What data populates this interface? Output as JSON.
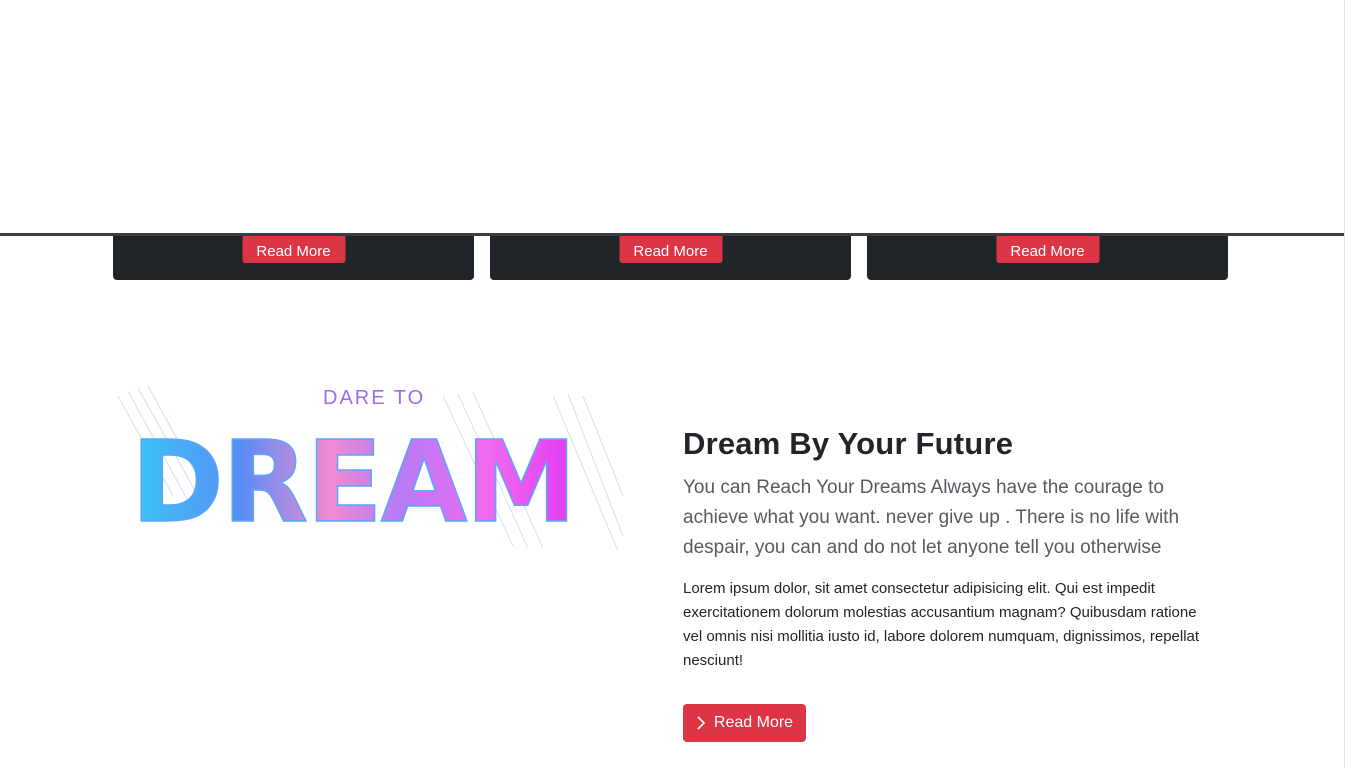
{
  "cards": [
    {
      "button_label": "Read More"
    },
    {
      "button_label": "Read More"
    },
    {
      "button_label": "Read More"
    }
  ],
  "feature": {
    "image_text_small": "DARE TO",
    "image_text_big": "DREAM",
    "title": "Dream By Your Future",
    "lead": "You can Reach Your Dreams Always have the courage to achieve what you want. never give up . There is no life with despair, you can and do not let anyone tell you otherwise",
    "body": "Lorem ipsum dolor, sit amet consectetur adipisicing elit. Qui est impedit exercitationem dolorum molestias accusantium magnam? Quibusdam ratione vel omnis nisi mollitia iusto id, labore dolorem numquam, dignissimos, repellat nesciunt!",
    "button_label": "Read More",
    "button_icon": "chevron-right-icon"
  },
  "colors": {
    "accent": "#dc3545",
    "card_bg": "#212529",
    "text": "#212529",
    "lead_text": "#555b61"
  }
}
